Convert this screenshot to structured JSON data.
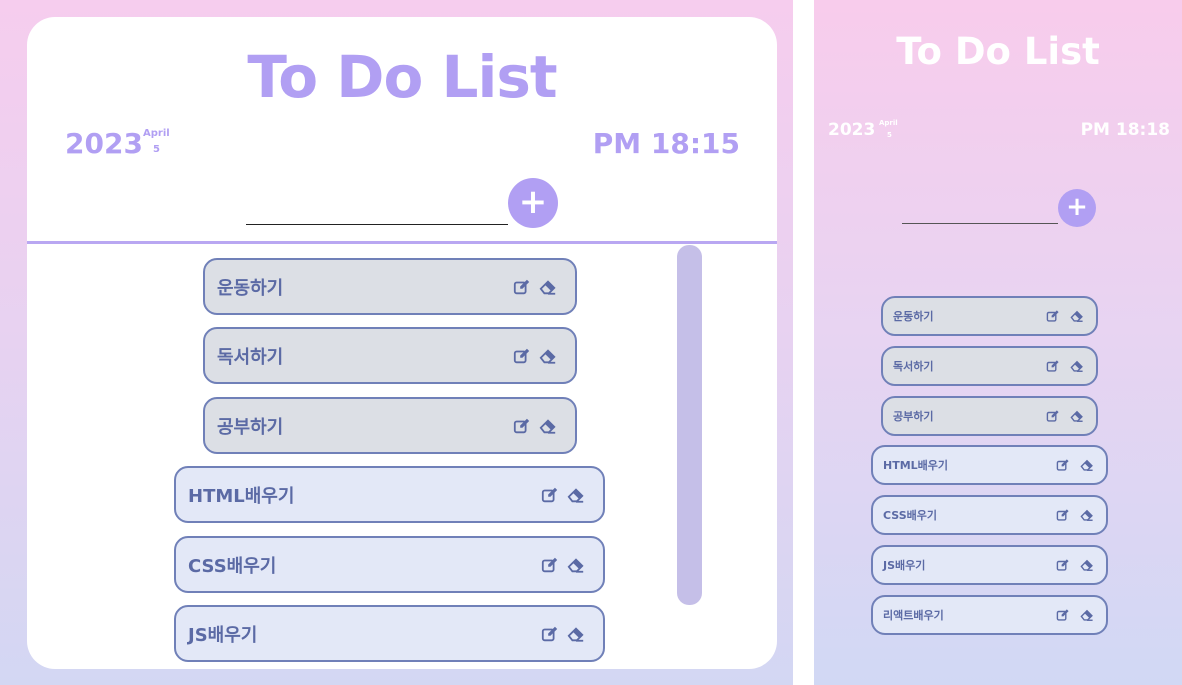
{
  "app": {
    "title": "To Do List",
    "year": "2023",
    "month": "April",
    "day": "5"
  },
  "left": {
    "clock": "PM 18:15",
    "add_label": "+",
    "items": [
      {
        "label": "운동하기",
        "state": "done"
      },
      {
        "label": "독서하기",
        "state": "done"
      },
      {
        "label": "공부하기",
        "state": "done"
      },
      {
        "label": "HTML배우기",
        "state": "todo"
      },
      {
        "label": "CSS배우기",
        "state": "todo"
      },
      {
        "label": "JS배우기",
        "state": "todo"
      }
    ]
  },
  "right": {
    "clock": "PM 18:18",
    "add_label": "+",
    "items": [
      {
        "label": "운동하기",
        "state": "done"
      },
      {
        "label": "독서하기",
        "state": "done"
      },
      {
        "label": "공부하기",
        "state": "done"
      },
      {
        "label": "HTML배우기",
        "state": "todo"
      },
      {
        "label": "CSS배우기",
        "state": "todo"
      },
      {
        "label": "JS배우기",
        "state": "todo"
      },
      {
        "label": "리액트배우기",
        "state": "todo"
      }
    ]
  },
  "icons": {
    "edit": "edit-icon",
    "erase": "eraser-icon"
  },
  "colors": {
    "accent": "#b19ff3",
    "item_border": "#7080b8",
    "done_bg": "#dcdfe5",
    "todo_bg": "#e3e8f7"
  }
}
